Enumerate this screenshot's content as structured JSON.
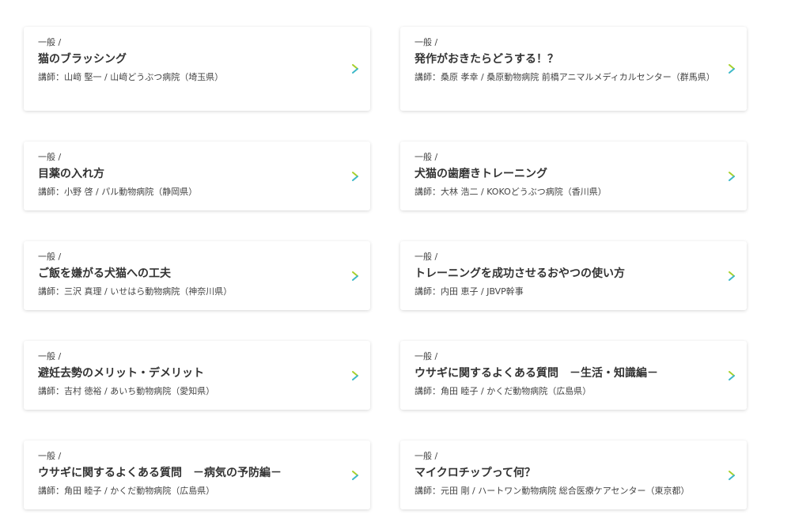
{
  "colors": {
    "arrow_primary": "#3cb8c8",
    "arrow_secondary": "#a7d02a"
  },
  "cards": [
    {
      "category": "一般 /",
      "title": "猫のブラッシング",
      "lecturer": "講師：山﨑 堅一 / 山﨑どうぶつ病院（埼玉県）",
      "icon": "chevron-right-icon"
    },
    {
      "category": "一般 /",
      "title": "発作がおきたらどうする！？",
      "lecturer": "講師：桑原 孝幸 / 桑原動物病院 前橋アニマルメディカルセンター（群馬県）",
      "icon": "chevron-right-icon"
    },
    {
      "category": "一般 /",
      "title": "目薬の入れ方",
      "lecturer": "講師：小野 啓 / パル動物病院（静岡県）",
      "icon": "chevron-right-icon"
    },
    {
      "category": "一般 /",
      "title": "犬猫の歯磨きトレーニング",
      "lecturer": "講師：大林 浩二 / KOKOどうぶつ病院（香川県）",
      "icon": "chevron-right-icon"
    },
    {
      "category": "一般 /",
      "title": "ご飯を嫌がる犬猫への工夫",
      "lecturer": "講師：三沢 真理 / いせはら動物病院（神奈川県）",
      "icon": "chevron-right-icon"
    },
    {
      "category": "一般 /",
      "title": "トレーニングを成功させるおやつの使い方",
      "lecturer": "講師：内田 恵子 / JBVP幹事",
      "icon": "chevron-right-icon"
    },
    {
      "category": "一般 /",
      "title": "避妊去勢のメリット・デメリット",
      "lecturer": "講師：吉村 徳裕 / あいち動物病院（愛知県）",
      "icon": "chevron-right-icon"
    },
    {
      "category": "一般 /",
      "title": "ウサギに関するよくある質問　－生活・知識編－",
      "lecturer": "講師：角田 睦子 / かくだ動物病院（広島県）",
      "icon": "chevron-right-icon"
    },
    {
      "category": "一般 /",
      "title": "ウサギに関するよくある質問　－病気の予防編－",
      "lecturer": "講師：角田 睦子 / かくだ動物病院（広島県）",
      "icon": "chevron-right-icon"
    },
    {
      "category": "一般 /",
      "title": "マイクロチップって何？",
      "lecturer": "講師：元田 剛 / ハートワン動物病院 総合医療ケアセンター（東京都）",
      "icon": "chevron-right-icon"
    }
  ]
}
